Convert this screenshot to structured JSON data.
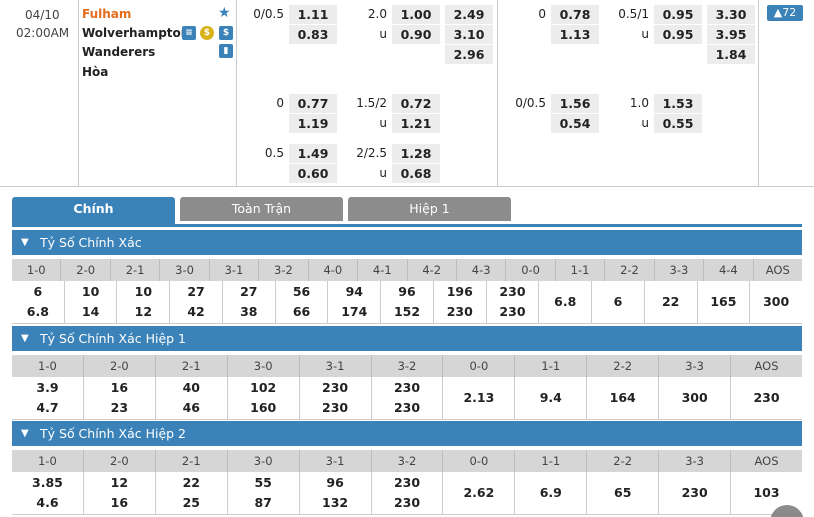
{
  "match": {
    "date": "04/10",
    "time": "02:00AM",
    "home": "Fulham",
    "away_line1": "Wolverhampton",
    "away_line2": "Wanderers",
    "draw": "Hòa",
    "more_count": "72",
    "colors": {
      "home": "#e46c1a",
      "accent": "#3a82b8",
      "star": "#3a82b8"
    }
  },
  "odds": {
    "r1": {
      "hc1": "0/0.5",
      "hc1_home": "1.11",
      "hc1_away": "0.83",
      "ou1": "2.0",
      "ou1_u": "u",
      "ou1_over": "1.00",
      "ou1_under": "0.90",
      "x1_1": "2.49",
      "x1_2": "3.10",
      "x1_3": "2.96",
      "hc2": "0",
      "hc2_home": "0.78",
      "hc2_away": "1.13",
      "ou2": "0.5/1",
      "ou2_u": "u",
      "ou2_over": "0.95",
      "ou2_under": "0.95",
      "x2_1": "3.30",
      "x2_2": "3.95",
      "x2_3": "1.84"
    },
    "r2": {
      "hc1": "0",
      "hc1_home": "0.77",
      "hc1_away": "1.19",
      "ou1": "1.5/2",
      "ou1_u": "u",
      "ou1_over": "0.72",
      "ou1_under": "1.21",
      "hc2": "0/0.5",
      "hc2_home": "1.56",
      "hc2_away": "0.54",
      "ou2": "1.0",
      "ou2_u": "u",
      "ou2_over": "1.53",
      "ou2_under": "0.55"
    },
    "r3": {
      "hc1": "0.5",
      "hc1_home": "1.49",
      "hc1_away": "0.60",
      "ou1": "2/2.5",
      "ou1_u": "u",
      "ou1_over": "1.28",
      "ou1_under": "0.68"
    }
  },
  "tabs": [
    {
      "label": "Chính",
      "active": true
    },
    {
      "label": "Toàn Trận",
      "active": false
    },
    {
      "label": "Hiệp 1",
      "active": false
    }
  ],
  "sections": [
    {
      "title": "Tỷ Số Chính Xác",
      "headers": [
        "1-0",
        "2-0",
        "2-1",
        "3-0",
        "3-1",
        "3-2",
        "4-0",
        "4-1",
        "4-2",
        "4-3",
        "0-0",
        "1-1",
        "2-2",
        "3-3",
        "4-4",
        "AOS"
      ],
      "cells": [
        [
          "6",
          "6.8"
        ],
        [
          "10",
          "14"
        ],
        [
          "10",
          "12"
        ],
        [
          "27",
          "42"
        ],
        [
          "27",
          "38"
        ],
        [
          "56",
          "66"
        ],
        [
          "94",
          "174"
        ],
        [
          "96",
          "152"
        ],
        [
          "196",
          "230"
        ],
        [
          "230",
          "230"
        ],
        [
          "6.8"
        ],
        [
          "6"
        ],
        [
          "22"
        ],
        [
          "165"
        ],
        [
          "300"
        ]
      ]
    },
    {
      "title": "Tỷ Số Chính Xác Hiệp 1",
      "headers": [
        "1-0",
        "2-0",
        "2-1",
        "3-0",
        "3-1",
        "3-2",
        "0-0",
        "1-1",
        "2-2",
        "3-3",
        "AOS"
      ],
      "cells": [
        [
          "3.9",
          "4.7"
        ],
        [
          "16",
          "23"
        ],
        [
          "40",
          "46"
        ],
        [
          "102",
          "160"
        ],
        [
          "230",
          "230"
        ],
        [
          "230",
          "230"
        ],
        [
          "2.13"
        ],
        [
          "9.4"
        ],
        [
          "164"
        ],
        [
          "300"
        ],
        [
          "230"
        ]
      ]
    },
    {
      "title": "Tỷ Số Chính Xác Hiệp 2",
      "headers": [
        "1-0",
        "2-0",
        "2-1",
        "3-0",
        "3-1",
        "3-2",
        "0-0",
        "1-1",
        "2-2",
        "3-3",
        "AOS"
      ],
      "cells": [
        [
          "3.85",
          "4.6"
        ],
        [
          "12",
          "16"
        ],
        [
          "22",
          "25"
        ],
        [
          "55",
          "87"
        ],
        [
          "96",
          "132"
        ],
        [
          "230",
          "230"
        ],
        [
          "2.62"
        ],
        [
          "6.9"
        ],
        [
          "65"
        ],
        [
          "230"
        ],
        [
          "103"
        ]
      ]
    }
  ]
}
